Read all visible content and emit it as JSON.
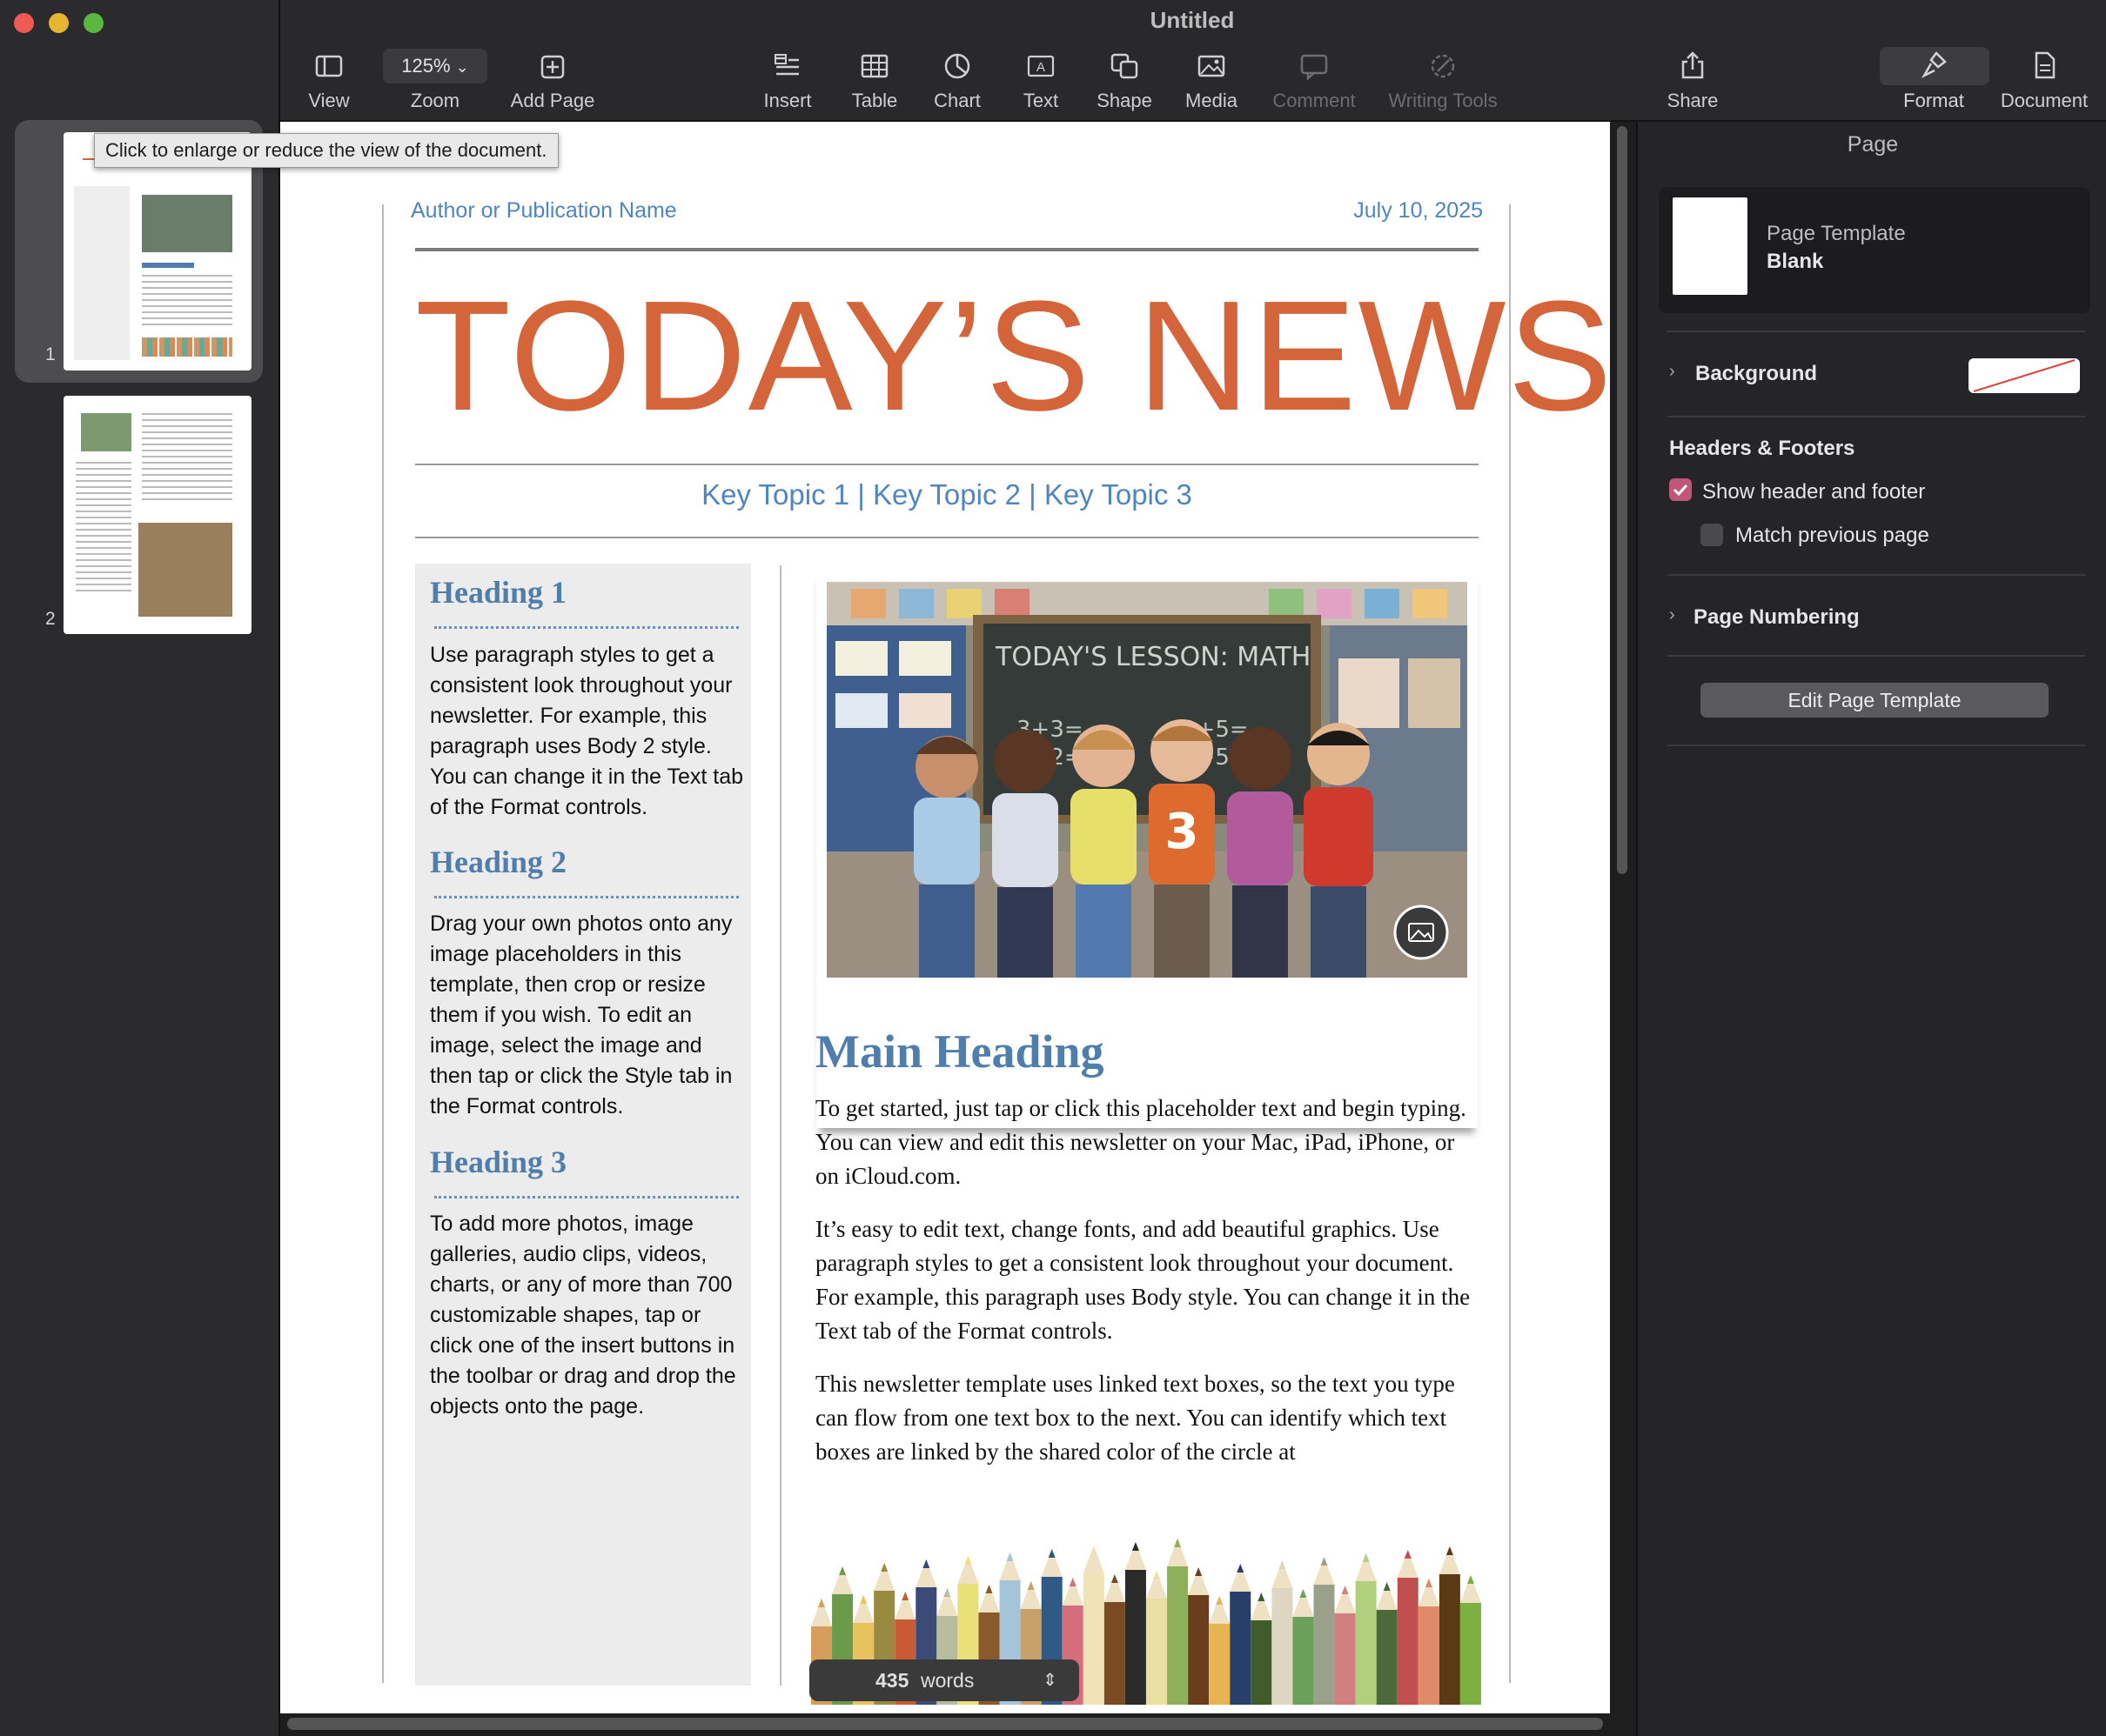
{
  "window": {
    "title": "Untitled"
  },
  "toolbar": {
    "view": "View",
    "zoom_value": "125%",
    "zoom": "Zoom",
    "add_page": "Add Page",
    "insert": "Insert",
    "table": "Table",
    "chart": "Chart",
    "text": "Text",
    "shape": "Shape",
    "media": "Media",
    "comment": "Comment",
    "writing_tools": "Writing Tools",
    "share": "Share",
    "format": "Format",
    "document": "Document"
  },
  "tooltip": "Click to enlarge or reduce the view of the document.",
  "thumbnails": [
    {
      "number": "1"
    },
    {
      "number": "2"
    }
  ],
  "document": {
    "author": "Author or Publication Name",
    "date": "July 10, 2025",
    "title": "TODAY’S NEWS",
    "topics": "Key Topic 1 | Key Topic 2 | Key Topic 3",
    "sidebar": [
      {
        "heading": "Heading 1",
        "body": "Use paragraph styles to get a consistent look throughout your newsletter. For example, this paragraph uses Body 2 style. You can change it in the Text tab of the Format controls."
      },
      {
        "heading": "Heading 2",
        "body": "Drag your own photos onto any image placeholders in this template, then crop or resize them if you wish. To edit an image, select the image and then tap or click the Style tab in the Format controls."
      },
      {
        "heading": "Heading 3",
        "body": "To add more photos, image galleries, audio clips, videos, charts, or any of more than 700 customizable shapes, tap or click one of the insert buttons in the toolbar or drag and drop the objects onto the page."
      }
    ],
    "image": {
      "chalkboard_text": "TODAY'S LESSON: MATH",
      "jersey_number": "3"
    },
    "main_heading": "Main Heading",
    "paragraphs": [
      "To get started, just tap or click this placeholder text and begin typing. You can view and edit this newsletter on your Mac, iPad, iPhone, or on iCloud.com.",
      "It’s easy to edit text, change fonts, and add beautiful graphics. Use paragraph styles to get a consistent look throughout your document. For example, this paragraph uses Body style. You can change it in the Text tab of the Format controls.",
      "This newsletter template uses linked text boxes, so the text you type can flow from one text box to the next. You can identify which text boxes are linked by the shared color of the circle at"
    ],
    "word_count": "435",
    "word_label": "words"
  },
  "inspector": {
    "title": "Page",
    "page_template_label": "Page Template",
    "page_template_value": "Blank",
    "background": "Background",
    "headers_footers": "Headers & Footers",
    "show_header_footer": "Show header and footer",
    "show_header_footer_checked": true,
    "match_previous": "Match previous page",
    "match_previous_checked": false,
    "page_numbering": "Page Numbering",
    "edit_template_button": "Edit Page Template"
  },
  "colors": {
    "accent": "#c0567a",
    "title_orange": "#d4643a",
    "heading_blue": "#4f7eac",
    "topics_blue": "#4f86c0"
  }
}
